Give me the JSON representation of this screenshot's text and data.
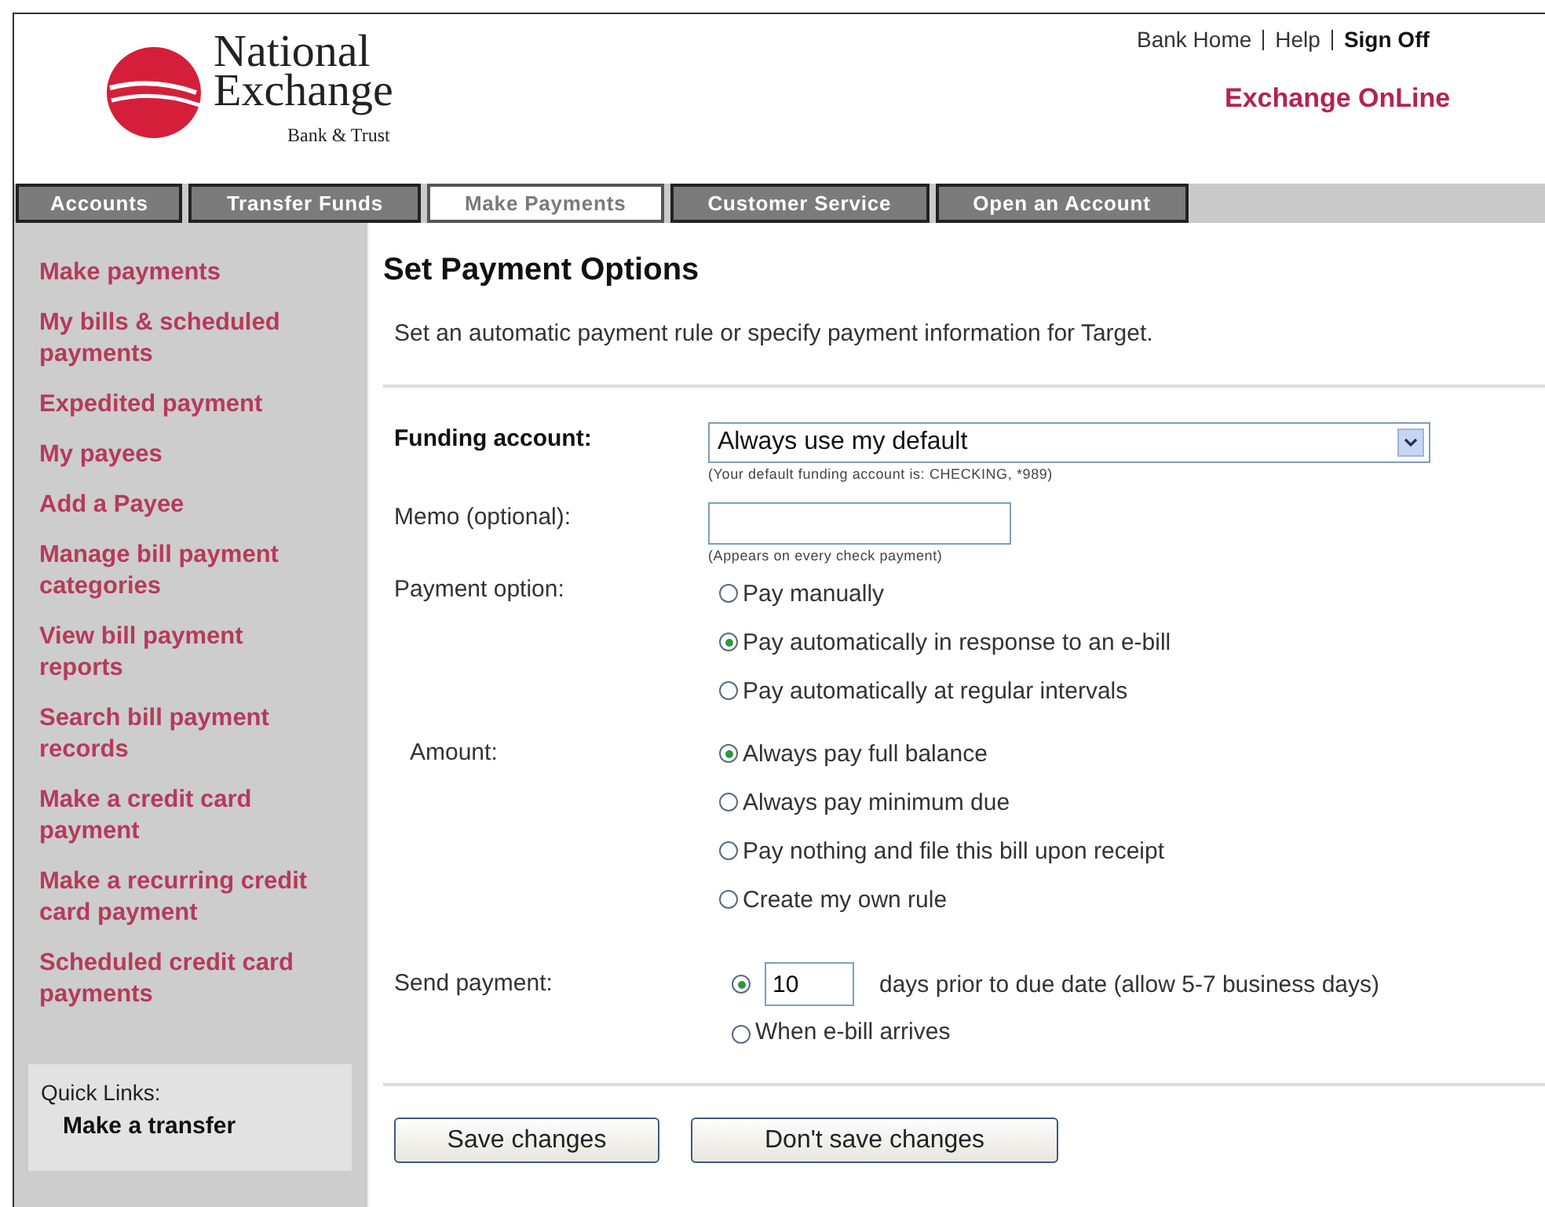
{
  "header": {
    "logo": {
      "line1": "National",
      "line2": "Exchange",
      "tagline": "Bank & Trust"
    },
    "top_links": [
      "Bank Home",
      "Help",
      "Sign Off"
    ],
    "product": "Exchange OnLine"
  },
  "nav_tabs": [
    {
      "label": "Accounts",
      "selected": false
    },
    {
      "label": "Transfer Funds",
      "selected": false
    },
    {
      "label": "Make Payments",
      "selected": true
    },
    {
      "label": "Customer Service",
      "selected": false
    },
    {
      "label": "Open an Account",
      "selected": false
    }
  ],
  "sidebar": {
    "items": [
      "Make payments",
      "My bills & scheduled payments",
      "Expedited payment",
      "My payees",
      "Add a Payee",
      "Manage bill payment categories",
      "View bill payment reports",
      "Search bill payment records",
      "Make a credit card payment",
      "Make a recurring credit card payment",
      "Scheduled credit card payments"
    ],
    "quick_links": {
      "title": "Quick Links:",
      "items": [
        "Make a transfer"
      ]
    }
  },
  "main": {
    "title": "Set Payment Options",
    "description": "Set an automatic payment rule or specify payment information for Target.",
    "funding_account": {
      "label": "Funding account:",
      "value": "Always use my default",
      "hint": "(Your default funding account is: CHECKING, *989)"
    },
    "memo": {
      "label": "Memo (optional):",
      "hint": "(Appears on every check payment)"
    },
    "payment_option": {
      "label": "Payment option:",
      "options": [
        {
          "label": "Pay manually",
          "selected": false
        },
        {
          "label": "Pay automatically in response to an e-bill",
          "selected": true
        },
        {
          "label": "Pay automatically at regular intervals",
          "selected": false
        }
      ]
    },
    "amount": {
      "label": "Amount:",
      "options": [
        {
          "label": "Always pay full balance",
          "selected": true
        },
        {
          "label": "Always pay minimum due",
          "selected": false
        },
        {
          "label": "Pay nothing and file this bill upon receipt",
          "selected": false
        },
        {
          "label": "Create my own rule",
          "selected": false
        }
      ]
    },
    "send_payment": {
      "label": "Send payment:",
      "options": [
        {
          "kind": "days",
          "days": "10",
          "label": "days prior to due date (allow 5-7 business days)",
          "selected": true
        },
        {
          "kind": "plain",
          "label": "When e-bill arrives",
          "selected": false
        }
      ]
    },
    "buttons": [
      "Save changes",
      "Don't save changes"
    ]
  }
}
